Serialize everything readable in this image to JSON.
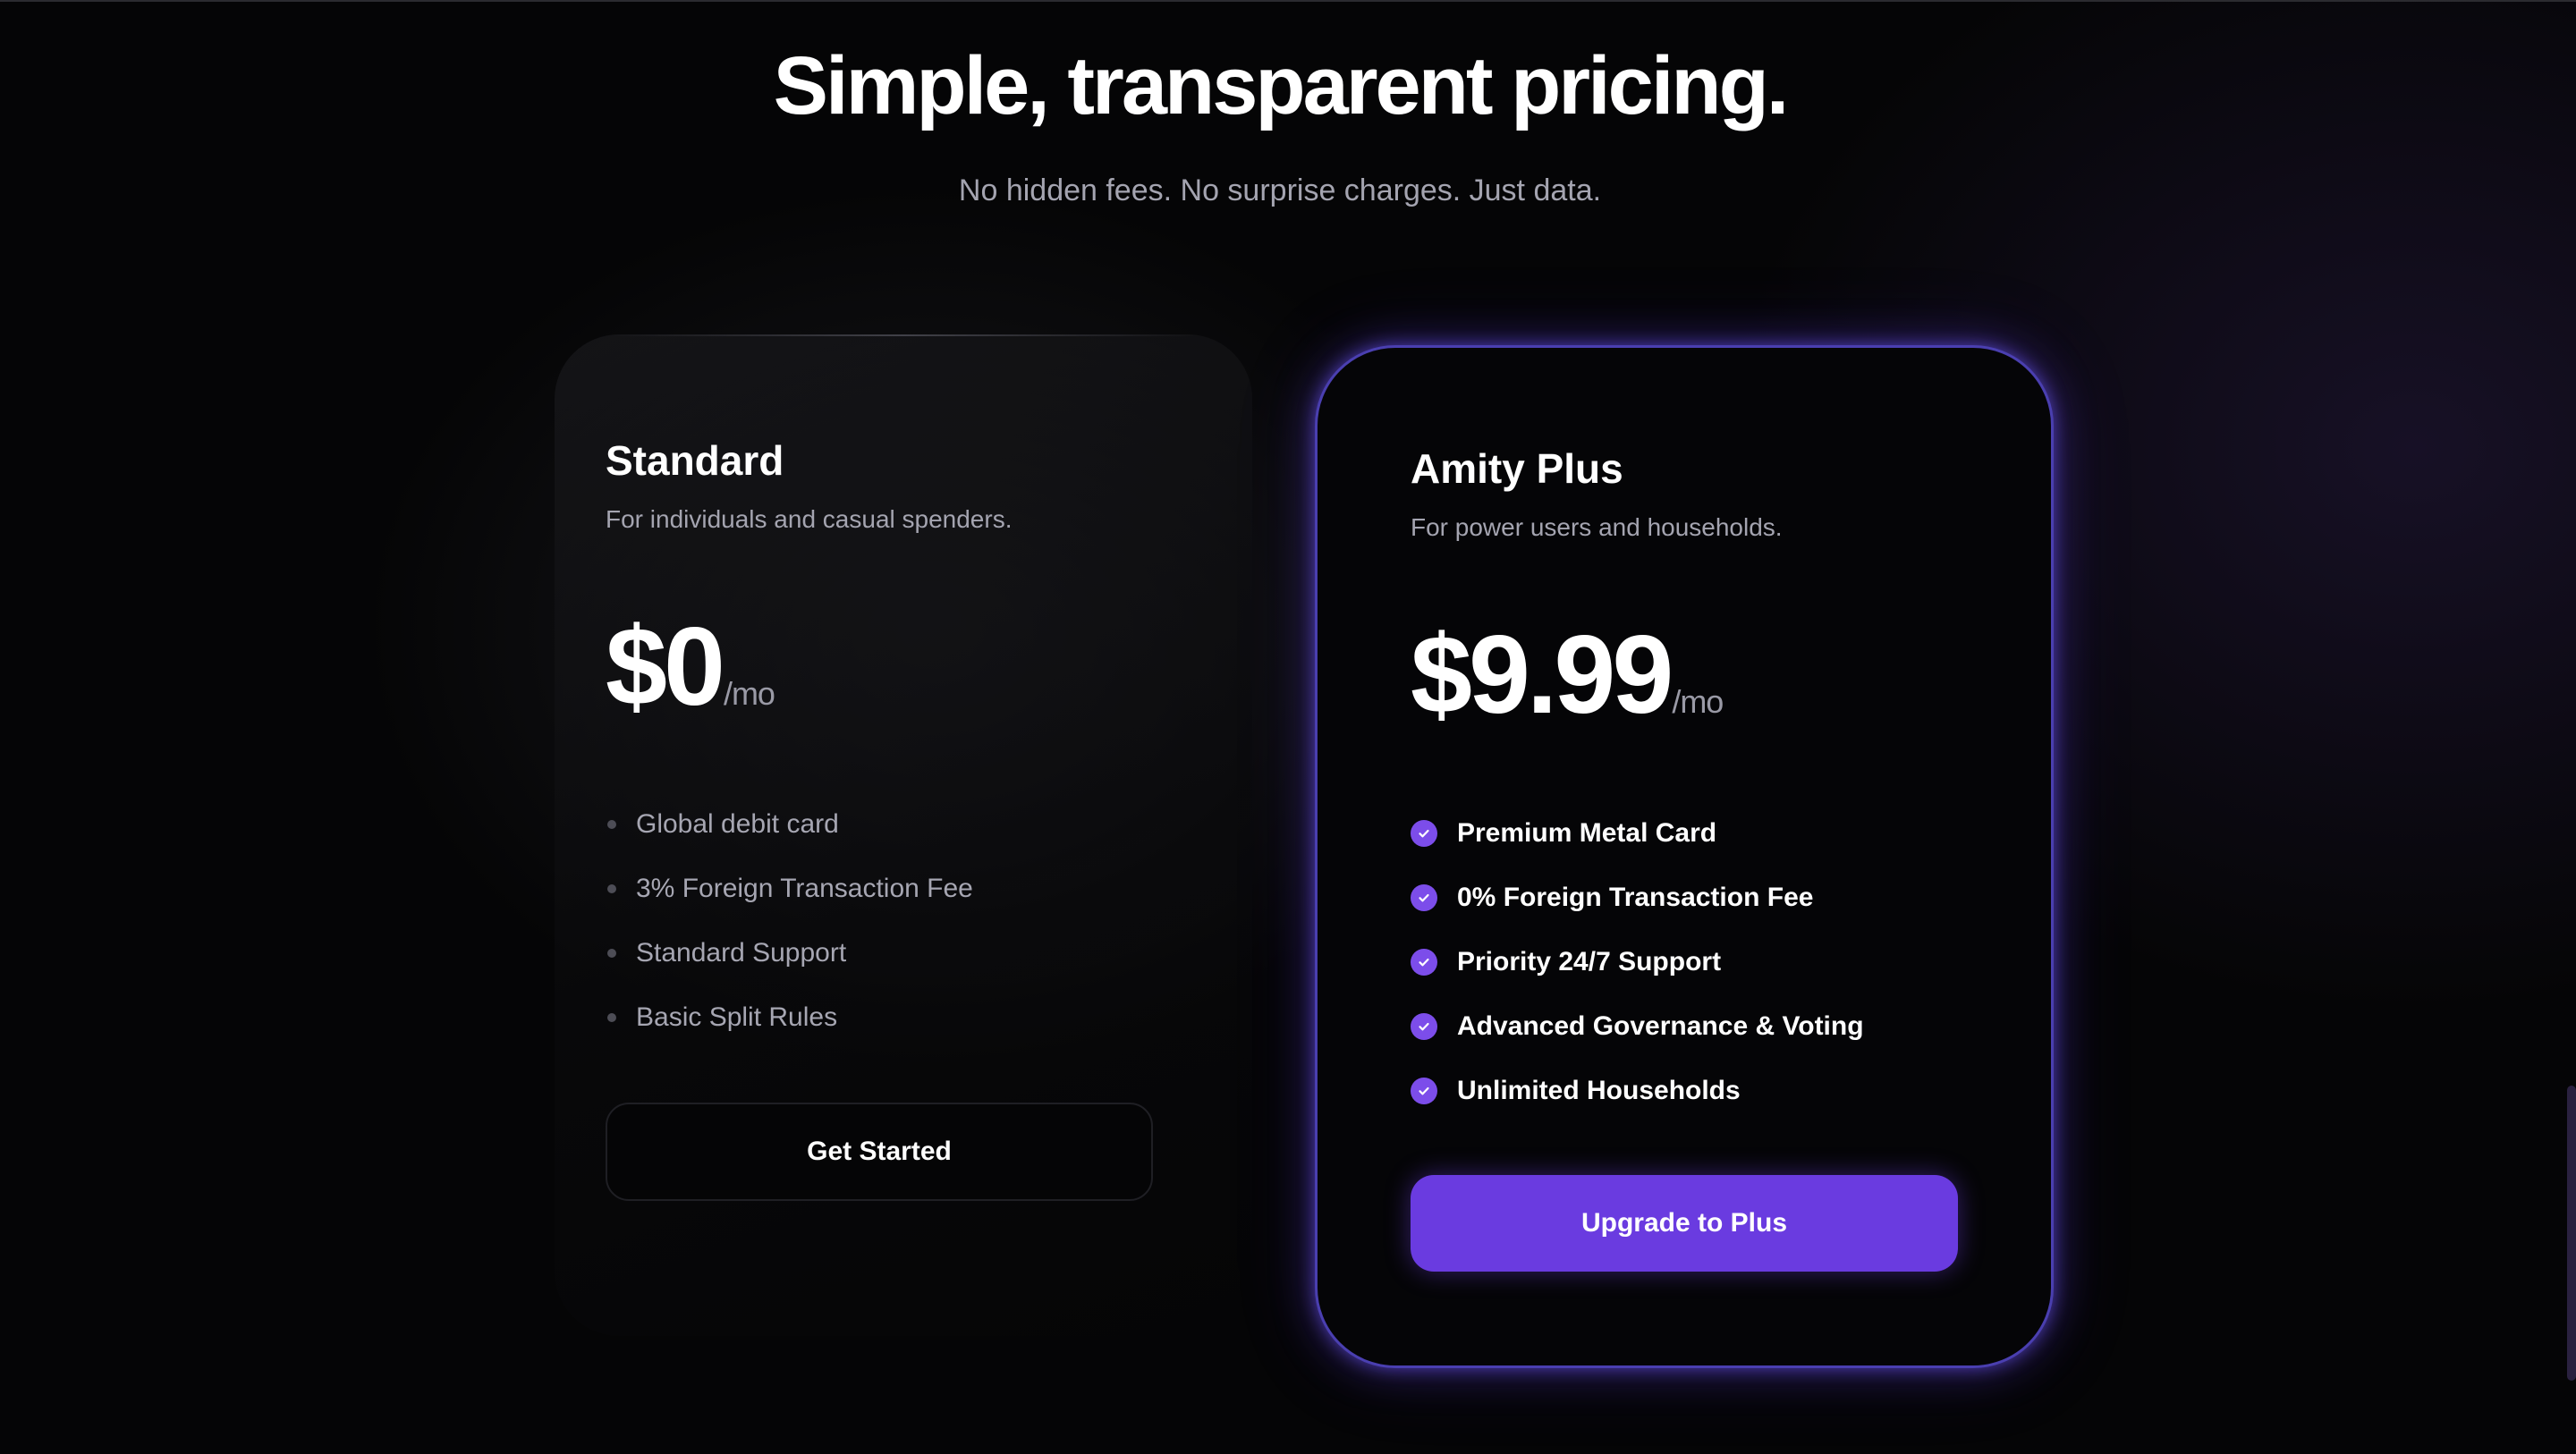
{
  "header": {
    "title": "Simple, transparent pricing.",
    "subtitle": "No hidden fees. No surprise charges. Just data."
  },
  "plans": [
    {
      "name": "Standard",
      "description": "For individuals and casual spenders.",
      "price": "$0",
      "period": "/mo",
      "features": [
        "Global debit card",
        "3% Foreign Transaction Fee",
        "Standard Support",
        "Basic Split Rules"
      ],
      "button_label": "Get Started"
    },
    {
      "name": "Amity Plus",
      "description": "For power users and households.",
      "price": "$9.99",
      "period": "/mo",
      "features": [
        "Premium Metal Card",
        "0% Foreign Transaction Fee",
        "Priority 24/7 Support",
        "Advanced Governance & Voting",
        "Unlimited Households"
      ],
      "button_label": "Upgrade to Plus"
    }
  ],
  "colors": {
    "accent": "#6a3be0",
    "check": "#7c4dea",
    "glow": "#4a3fb0",
    "background": "#050506",
    "muted_text": "#a4a4b0"
  },
  "icons": {
    "standard_bullet": "dot-icon",
    "plus_bullet": "check-circle-icon"
  }
}
